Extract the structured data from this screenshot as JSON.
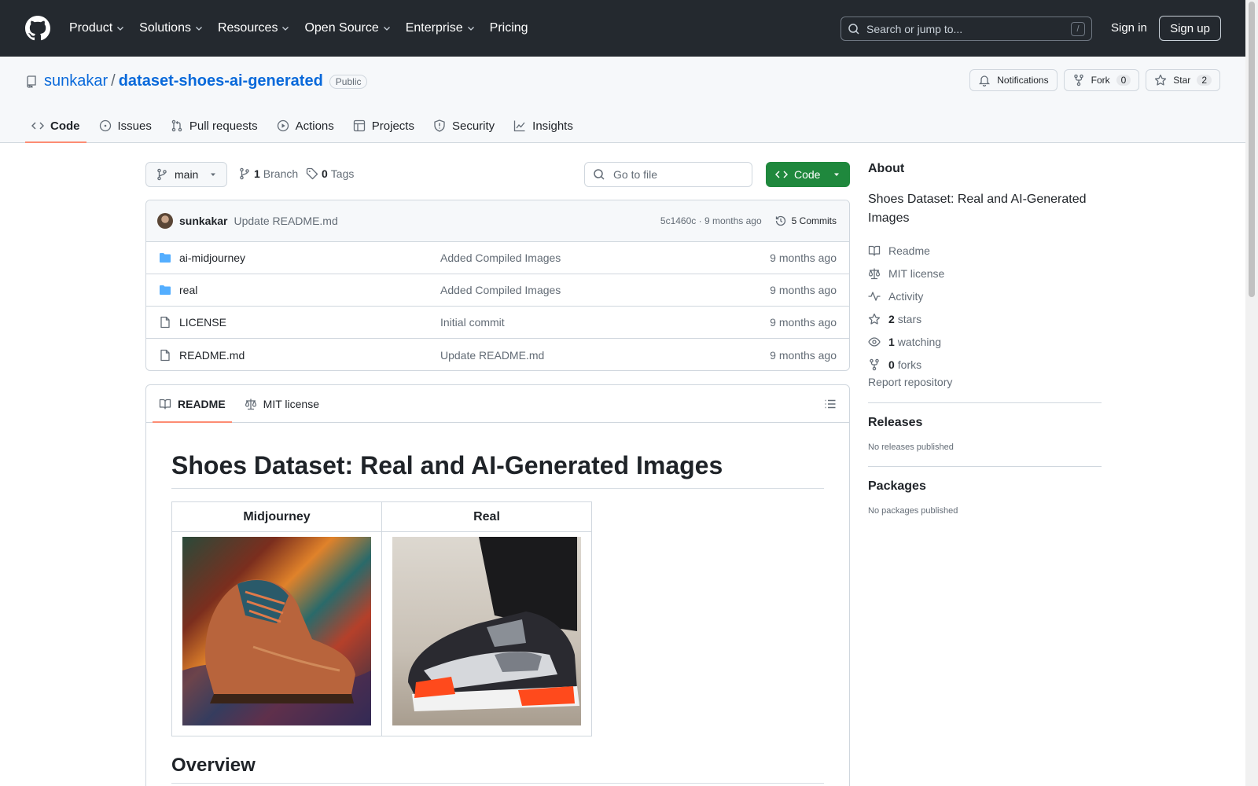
{
  "header": {
    "nav": [
      "Product",
      "Solutions",
      "Resources",
      "Open Source",
      "Enterprise",
      "Pricing"
    ],
    "search_placeholder": "Search or jump to...",
    "search_shortcut": "/",
    "signin": "Sign in",
    "signup": "Sign up"
  },
  "repo": {
    "owner": "sunkakar",
    "sep": "/",
    "name": "dataset-shoes-ai-generated",
    "visibility": "Public",
    "notifications_label": "Notifications",
    "fork_label": "Fork",
    "fork_count": "0",
    "star_label": "Star",
    "star_count": "2",
    "tabs": [
      "Code",
      "Issues",
      "Pull requests",
      "Actions",
      "Projects",
      "Security",
      "Insights"
    ]
  },
  "branch": {
    "name": "main",
    "branch_count": "1",
    "branch_label": "Branch",
    "tag_count": "0",
    "tag_label": "Tags",
    "goto_file": "Go to file",
    "code_label": "Code"
  },
  "commit": {
    "author": "sunkakar",
    "message": "Update README.md",
    "meta": "5c1460c · 9 months ago",
    "commits_label": "5 Commits"
  },
  "files": [
    {
      "type": "folder",
      "name": "ai-midjourney",
      "message": "Added Compiled Images",
      "date": "9 months ago"
    },
    {
      "type": "folder",
      "name": "real",
      "message": "Added Compiled Images",
      "date": "9 months ago"
    },
    {
      "type": "file",
      "name": "LICENSE",
      "message": "Initial commit",
      "date": "9 months ago"
    },
    {
      "type": "file",
      "name": "README.md",
      "message": "Update README.md",
      "date": "9 months ago"
    }
  ],
  "readme": {
    "tab_readme": "README",
    "tab_license": "MIT license",
    "title": "Shoes Dataset: Real and AI-Generated Images",
    "table_headers": [
      "Midjourney",
      "Real"
    ],
    "overview": "Overview"
  },
  "sidebar": {
    "about_title": "About",
    "description": "Shoes Dataset: Real and AI-Generated Images",
    "readme": "Readme",
    "license": "MIT license",
    "activity": "Activity",
    "stars_count": "2",
    "stars_label": "stars",
    "watching_count": "1",
    "watching_label": "watching",
    "forks_count": "0",
    "forks_label": "forks",
    "report": "Report repository",
    "releases_title": "Releases",
    "releases_empty": "No releases published",
    "packages_title": "Packages",
    "packages_empty": "No packages published"
  },
  "colors": {
    "header_bg": "#24292f",
    "link": "#0969da",
    "code_button": "#1f883d",
    "active_tab_underline": "#fd8c73",
    "folder": "#54aeff"
  }
}
